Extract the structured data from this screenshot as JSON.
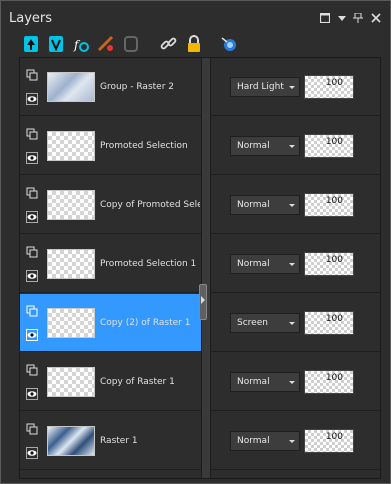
{
  "panel": {
    "title": "Layers"
  },
  "toolbar": {
    "icons": [
      "new-raster-layer-icon",
      "new-vector-layer-icon",
      "new-adjustment-layer-icon",
      "delete-layer-icon",
      "mask-icon",
      "link-icon",
      "lock-icon",
      "highlight-icon"
    ]
  },
  "layers": [
    {
      "name": "Group - Raster 2",
      "blend": "Hard Light",
      "opacity": "100",
      "thumb": "filled-blue",
      "selected": false
    },
    {
      "name": "Promoted Selection",
      "blend": "Normal",
      "opacity": "100",
      "thumb": "checker",
      "selected": false
    },
    {
      "name": "Copy of Promoted Selection",
      "blend": "Normal",
      "opacity": "100",
      "thumb": "checker",
      "selected": false
    },
    {
      "name": "Promoted Selection 1",
      "blend": "Normal",
      "opacity": "100",
      "thumb": "checker",
      "selected": false
    },
    {
      "name": "Copy (2) of Raster 1",
      "blend": "Screen",
      "opacity": "100",
      "thumb": "checker",
      "selected": true
    },
    {
      "name": "Copy of Raster 1",
      "blend": "Normal",
      "opacity": "100",
      "thumb": "checker",
      "selected": false
    },
    {
      "name": "Raster 1",
      "blend": "Normal",
      "opacity": "100",
      "thumb": "filled-dark",
      "selected": false
    }
  ],
  "colors": {
    "selection": "#3399ff",
    "accent": "#00c4e6",
    "lock": "#f2b705"
  }
}
